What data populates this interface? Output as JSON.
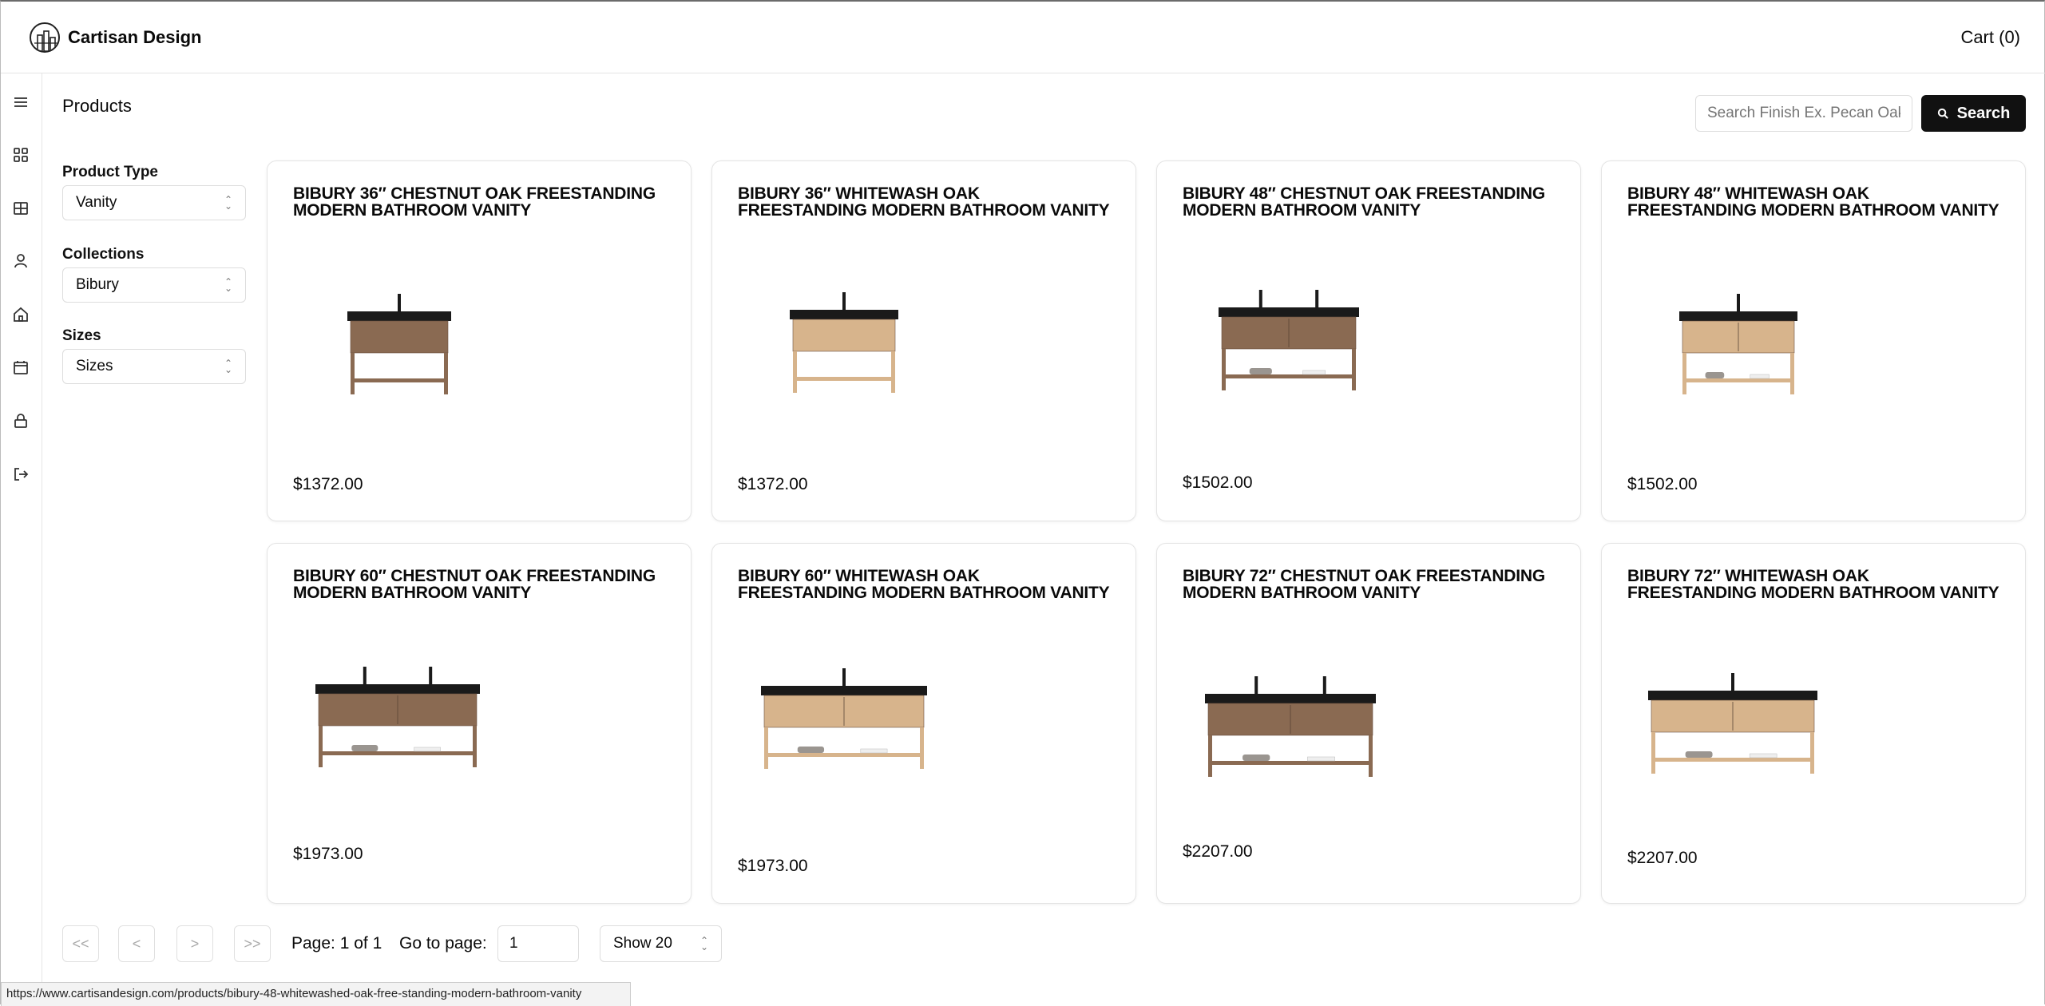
{
  "header": {
    "brand": "Cartisan Design",
    "cart": "Cart (0)"
  },
  "sidebar": {
    "icons": [
      "menu-icon",
      "grid-icon",
      "table-icon",
      "user-icon",
      "home-icon",
      "calendar-icon",
      "lock-icon",
      "logout-icon"
    ]
  },
  "main": {
    "title": "Products",
    "search": {
      "placeholder": "Search Finish Ex. Pecan Oak",
      "button": "Search"
    }
  },
  "filters": [
    {
      "label": "Product Type",
      "value": "Vanity"
    },
    {
      "label": "Collections",
      "value": "Bibury"
    },
    {
      "label": "Sizes",
      "value": "Sizes"
    }
  ],
  "products": [
    {
      "title": "BIBURY 36″ CHESTNUT OAK FREESTANDING MODERN BATHROOM VANITY",
      "price": "$1372.00",
      "finish": "chestnut"
    },
    {
      "title": "BIBURY 36″ WHITEWASH OAK FREESTANDING MODERN BATHROOM VANITY",
      "price": "$1372.00",
      "finish": "whitewash"
    },
    {
      "title": "BIBURY 48″ CHESTNUT OAK FREESTANDING MODERN BATHROOM VANITY",
      "price": "$1502.00",
      "finish": "chestnut"
    },
    {
      "title": "BIBURY 48″ WHITEWASH OAK FREESTANDING MODERN BATHROOM VANITY",
      "price": "$1502.00",
      "finish": "whitewash"
    },
    {
      "title": "BIBURY 60″ CHESTNUT OAK FREESTANDING MODERN BATHROOM VANITY",
      "price": "$1973.00",
      "finish": "chestnut"
    },
    {
      "title": "BIBURY 60″ WHITEWASH OAK FREESTANDING MODERN BATHROOM VANITY",
      "price": "$1973.00",
      "finish": "whitewash"
    },
    {
      "title": "BIBURY 72″ CHESTNUT OAK FREESTANDING MODERN BATHROOM VANITY",
      "price": "$2207.00",
      "finish": "chestnut"
    },
    {
      "title": "BIBURY 72″ WHITEWASH OAK FREESTANDING MODERN BATHROOM VANITY",
      "price": "$2207.00",
      "finish": "whitewash"
    }
  ],
  "pagination": {
    "first": "<<",
    "prev": "<",
    "next": ">",
    "last": ">>",
    "page_text": "Page: 1 of 1",
    "goto_label": "Go to page:",
    "goto_value": "1",
    "show": "Show 20"
  },
  "status_url": "https://www.cartisandesign.com/products/bibury-48-whitewashed-oak-free-standing-modern-bathroom-vanity",
  "colors": {
    "chestnut": "#8a6a52",
    "whitewash": "#d7b48c",
    "top": "#1a1a1a",
    "accent": "#111111"
  }
}
